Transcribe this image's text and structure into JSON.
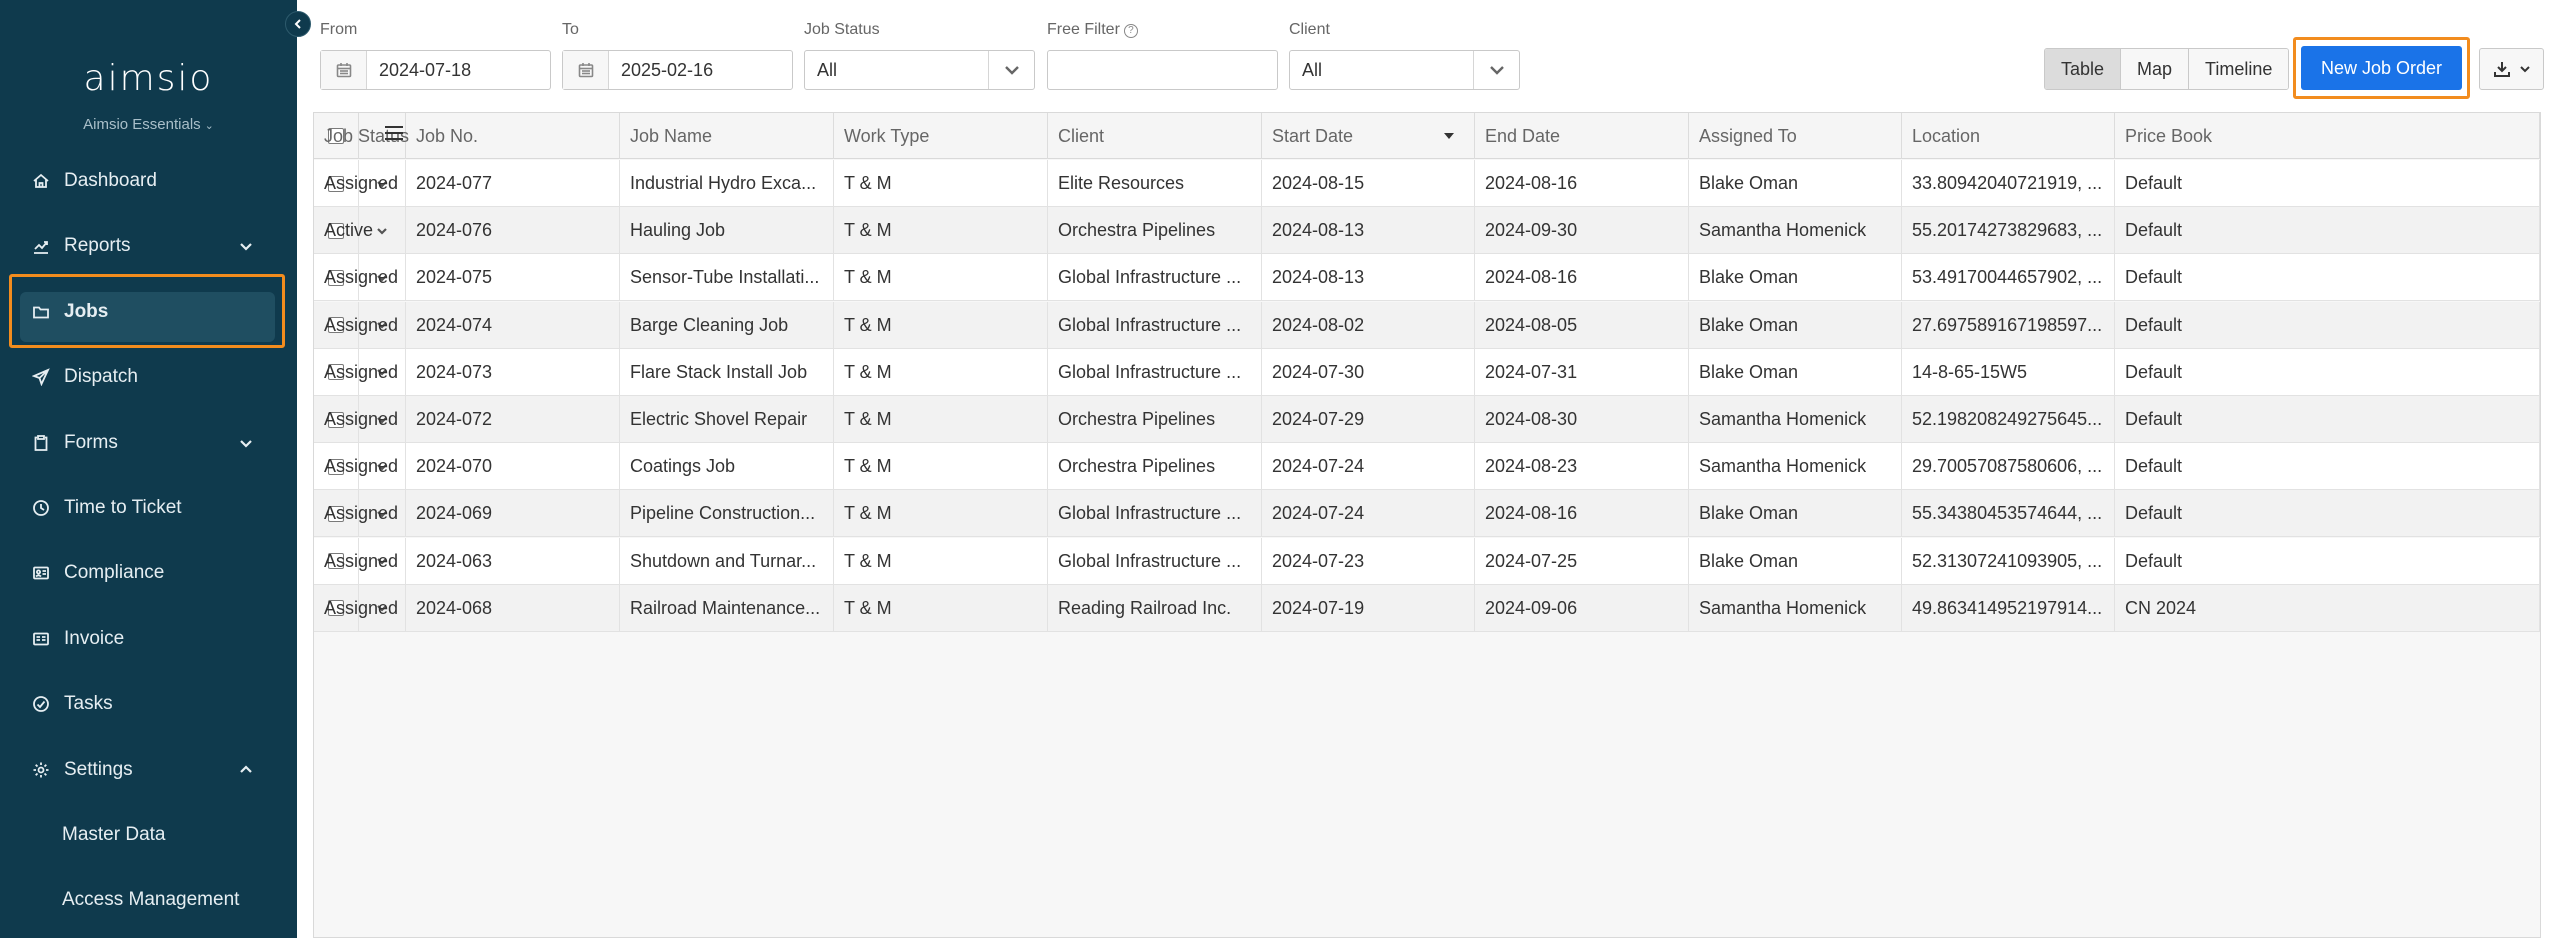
{
  "sidebar": {
    "logo": "aimsio",
    "plan": "Aimsio Essentials",
    "items": [
      {
        "label": "Dashboard",
        "icon": "home-icon",
        "name": "dashboard"
      },
      {
        "label": "Reports",
        "icon": "chart-line-icon",
        "name": "reports",
        "caret": "down"
      },
      {
        "label": "Jobs",
        "icon": "folder-icon",
        "name": "jobs",
        "active": true
      },
      {
        "label": "Dispatch",
        "icon": "paper-plane-icon",
        "name": "dispatch"
      },
      {
        "label": "Forms",
        "icon": "clipboard-icon",
        "name": "forms",
        "caret": "down"
      },
      {
        "label": "Time to Ticket",
        "icon": "clock-icon",
        "name": "time-to-ticket"
      },
      {
        "label": "Compliance",
        "icon": "id-card-icon",
        "name": "compliance"
      },
      {
        "label": "Invoice",
        "icon": "invoice-icon",
        "name": "invoice"
      },
      {
        "label": "Tasks",
        "icon": "check-circle-icon",
        "name": "tasks"
      },
      {
        "label": "Settings",
        "icon": "gear-icon",
        "name": "settings",
        "caret": "up"
      },
      {
        "label": "Master Data",
        "name": "master-data",
        "sub": true
      },
      {
        "label": "Access Management",
        "name": "access-management",
        "sub": true
      }
    ]
  },
  "filters": {
    "from_label": "From",
    "from_value": "2024-07-18",
    "to_label": "To",
    "to_value": "2025-02-16",
    "status_label": "Job Status",
    "status_value": "All",
    "free_label": "Free Filter",
    "free_value": "",
    "client_label": "Client",
    "client_value": "All"
  },
  "toolbar": {
    "views": [
      "Table",
      "Map",
      "Timeline"
    ],
    "selected_view": "Table",
    "new_job_label": "New Job Order"
  },
  "table": {
    "columns": [
      "Job No.",
      "Job Name",
      "Work Type",
      "Client",
      "Start Date",
      "End Date",
      "Assigned To",
      "Location",
      "Price Book",
      "Job Status"
    ],
    "sorted_column": "Start Date",
    "rows": [
      [
        "2024-077",
        "Industrial Hydro Exca...",
        "T & M",
        "Elite Resources",
        "2024-08-15",
        "2024-08-16",
        "Blake Oman",
        "33.80942040721919, ...",
        "Default",
        "Assigned"
      ],
      [
        "2024-076",
        "Hauling Job",
        "T & M",
        "Orchestra Pipelines",
        "2024-08-13",
        "2024-09-30",
        "Samantha Homenick",
        "55.20174273829683, ...",
        "Default",
        "Active"
      ],
      [
        "2024-075",
        "Sensor-Tube Installati...",
        "T & M",
        "Global Infrastructure ...",
        "2024-08-13",
        "2024-08-16",
        "Blake Oman",
        "53.49170044657902, ...",
        "Default",
        "Assigned"
      ],
      [
        "2024-074",
        "Barge Cleaning Job",
        "T & M",
        "Global Infrastructure ...",
        "2024-08-02",
        "2024-08-05",
        "Blake Oman",
        "27.697589167198597...",
        "Default",
        "Assigned"
      ],
      [
        "2024-073",
        "Flare Stack Install Job",
        "T & M",
        "Global Infrastructure ...",
        "2024-07-30",
        "2024-07-31",
        "Blake Oman",
        "14-8-65-15W5",
        "Default",
        "Assigned"
      ],
      [
        "2024-072",
        "Electric Shovel Repair",
        "T & M",
        "Orchestra Pipelines",
        "2024-07-29",
        "2024-08-30",
        "Samantha Homenick",
        "52.198208249275645...",
        "Default",
        "Assigned"
      ],
      [
        "2024-070",
        "Coatings Job",
        "T & M",
        "Orchestra Pipelines",
        "2024-07-24",
        "2024-08-23",
        "Samantha Homenick",
        "29.70057087580606, ...",
        "Default",
        "Assigned"
      ],
      [
        "2024-069",
        "Pipeline Construction...",
        "T & M",
        "Global Infrastructure ...",
        "2024-07-24",
        "2024-08-16",
        "Blake Oman",
        "55.34380453574644, ...",
        "Default",
        "Assigned"
      ],
      [
        "2024-063",
        "Shutdown and Turnar...",
        "T & M",
        "Global Infrastructure ...",
        "2024-07-23",
        "2024-07-25",
        "Blake Oman",
        "52.31307241093905, ...",
        "Default",
        "Assigned"
      ],
      [
        "2024-068",
        "Railroad Maintenance...",
        "T & M",
        "Reading Railroad Inc.",
        "2024-07-19",
        "2024-09-06",
        "Samantha Homenick",
        "49.863414952197914...",
        "CN 2024",
        "Assigned"
      ]
    ]
  },
  "colors": {
    "sidebar_bg": "#0f3a4d",
    "accent": "#1a73e8",
    "highlight": "#f28c1e"
  }
}
